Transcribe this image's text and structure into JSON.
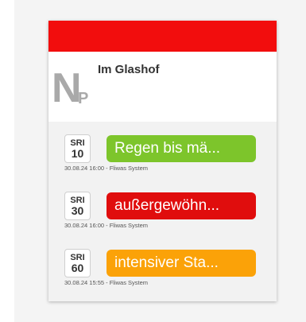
{
  "station": {
    "icon_main": "N",
    "icon_sub": "P",
    "title": "Im Glashof",
    "topbar_color": "#f20d0d"
  },
  "warnings": [
    {
      "sri_label": "SRI",
      "sri_value": "10",
      "text": "Regen bis mä...",
      "color": "#7dc52b",
      "meta": "30.08.24 16:00 - Fliwas System"
    },
    {
      "sri_label": "SRI",
      "sri_value": "30",
      "text": "außergewöhn...",
      "color": "#e00d0d",
      "meta": "30.08.24 16:00 - Fliwas System"
    },
    {
      "sri_label": "SRI",
      "sri_value": "60",
      "text": "intensiver Sta...",
      "color": "#fba208",
      "meta": "30.08.24 15:55 - Fliwas System"
    }
  ]
}
